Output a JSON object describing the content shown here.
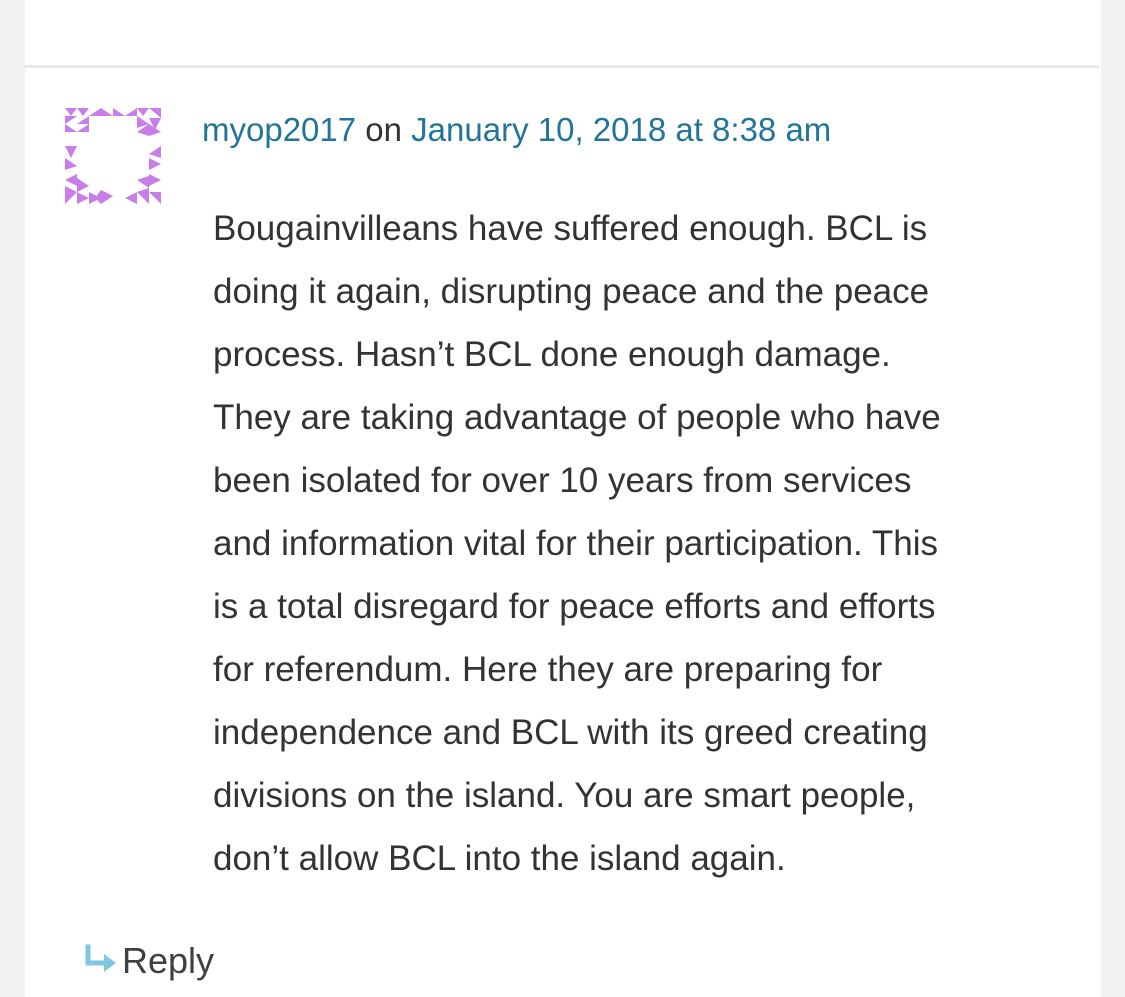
{
  "comment": {
    "author": "myop2017",
    "separator": "on",
    "date": "January 10, 2018 at 8:38 am",
    "lines": [
      "Bougainvilleans have suffered enough. BCL is",
      "doing it again, disrupting peace and the peace",
      "process. Hasn’t BCL done enough damage.",
      "They are taking advantage of people who have",
      "been isolated for over 10 years from services",
      "and information vital for their participation. This",
      "is a total disregard for peace efforts and efforts",
      "for referendum. Here they are preparing for",
      "independence and BCL with its greed creating",
      "divisions on the island. You are smart people,",
      "don’t allow BCL into the island again."
    ],
    "reply_label": "Reply",
    "reply_icon": "reply-arrow-icon"
  },
  "colors": {
    "link": "#21759b",
    "text": "#333333",
    "avatar": "#c77ee8",
    "reply_icon": "#7fc6e3",
    "background": "#f1f1f1"
  }
}
